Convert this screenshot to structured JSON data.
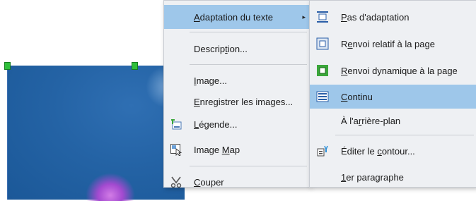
{
  "main_menu": {
    "items": [
      {
        "pre": "",
        "ul": "A",
        "post": "daptation du texte",
        "submenu_arrow": "▸"
      },
      {
        "pre": "Descrip",
        "ul": "t",
        "post": "ion..."
      },
      {
        "pre": "",
        "ul": "I",
        "post": "mage..."
      },
      {
        "pre": "",
        "ul": "E",
        "post": "nregistrer les images..."
      },
      {
        "pre": "",
        "ul": "L",
        "post": "égende..."
      },
      {
        "pre": "Image ",
        "ul": "M",
        "post": "ap"
      },
      {
        "pre": "",
        "ul": "C",
        "post": "ouper"
      }
    ]
  },
  "sub_menu": {
    "items": [
      {
        "pre": "",
        "ul": "P",
        "post": "as d'adaptation"
      },
      {
        "pre": "R",
        "ul": "e",
        "post": "nvoi relatif à la page"
      },
      {
        "pre": "",
        "ul": "R",
        "post": "envoi dynamique à la page"
      },
      {
        "pre": "",
        "ul": "C",
        "post": "ontinu"
      },
      {
        "pre": "À l'a",
        "ul": "r",
        "post": "rière-plan"
      },
      {
        "pre": "Éditer le ",
        "ul": "c",
        "post": "ontour..."
      },
      {
        "pre": "",
        "ul": "1",
        "post": "er paragraphe"
      }
    ]
  },
  "colors": {
    "highlight": "#9ec7ea",
    "menu_bg": "#eef0f3",
    "image_blue": "#2463a5",
    "handle_green": "#2fbf3a"
  }
}
